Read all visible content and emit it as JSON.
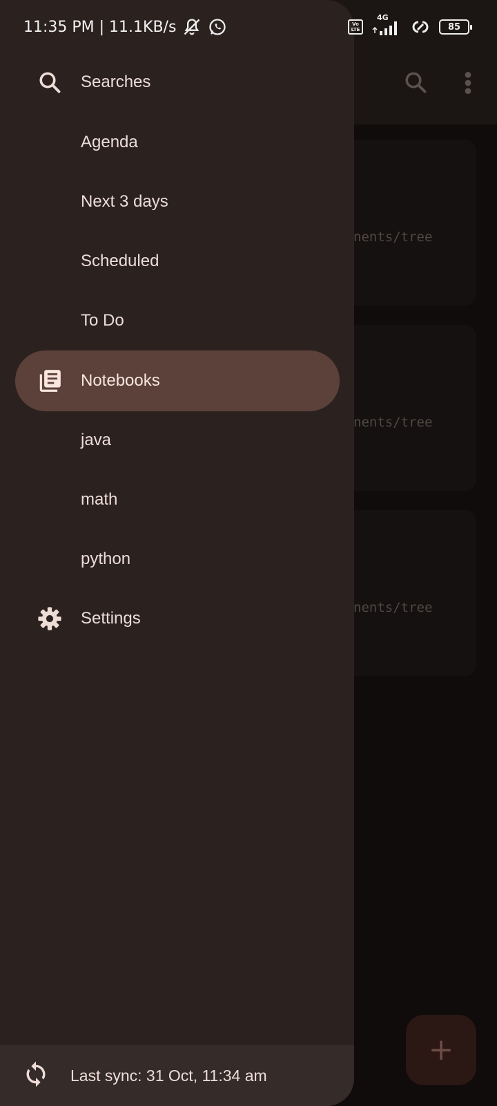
{
  "status_bar": {
    "time_speed": "11:35 PM | 11.1KB/s",
    "network": "4G",
    "volte_top": "Vo",
    "volte_bottom": "LTE",
    "battery": "85"
  },
  "background": {
    "cards": [
      {
        "path": "nents/tree"
      },
      {
        "path": "nents/tree"
      },
      {
        "path": "nents/tree"
      }
    ],
    "fab_label": "+"
  },
  "drawer": {
    "items": [
      {
        "label": "Searches",
        "icon": "search-icon"
      },
      {
        "label": "Agenda"
      },
      {
        "label": "Next 3 days"
      },
      {
        "label": "Scheduled"
      },
      {
        "label": "To Do"
      },
      {
        "label": "Notebooks",
        "icon": "notebooks-icon",
        "active": true
      },
      {
        "label": "java"
      },
      {
        "label": "math"
      },
      {
        "label": "python"
      },
      {
        "label": "Settings",
        "icon": "gear-icon"
      }
    ],
    "sync_text": "Last sync: 31 Oct, 11:34 am"
  },
  "colors": {
    "drawer_bg": "#2b2220",
    "active_item_bg": "#5c413a",
    "text": "#eedcd6",
    "sync_bar_bg": "#352c2a"
  }
}
